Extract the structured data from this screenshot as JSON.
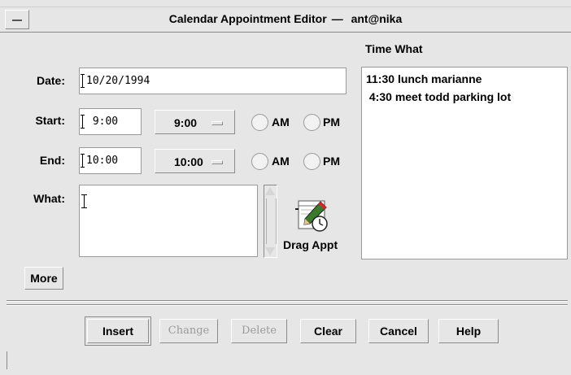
{
  "window": {
    "title": "Calendar Appointment Editor",
    "title_separator": "—",
    "title_user": "ant@nika"
  },
  "form": {
    "date_label": "Date:",
    "date_value": "10/20/1994",
    "start_label": "Start:",
    "start_value": " 9:00",
    "start_menu": "9:00",
    "end_label": "End:",
    "end_value": "10:00",
    "end_menu": "10:00",
    "am_label": "AM",
    "pm_label": "PM",
    "what_label": "What:",
    "what_value": "",
    "drag_label": "Drag Appt",
    "more_label": "More"
  },
  "list": {
    "header_time": "Time",
    "header_what": "What",
    "items": [
      {
        "time": "11:30",
        "what": "lunch marianne"
      },
      {
        "time": " 4:30",
        "what": "meet todd parking lot"
      }
    ]
  },
  "buttons": {
    "insert": "Insert",
    "change": "Change",
    "delete": "Delete",
    "clear": "Clear",
    "cancel": "Cancel",
    "help": "Help"
  },
  "colors": {
    "background": "#e6e6e6",
    "field_bg": "#ffffff",
    "disabled_text": "#9a9a9a"
  },
  "icons": {
    "window_menu": "window-menu-icon",
    "drag_appt": "drag-appointment-icon"
  }
}
